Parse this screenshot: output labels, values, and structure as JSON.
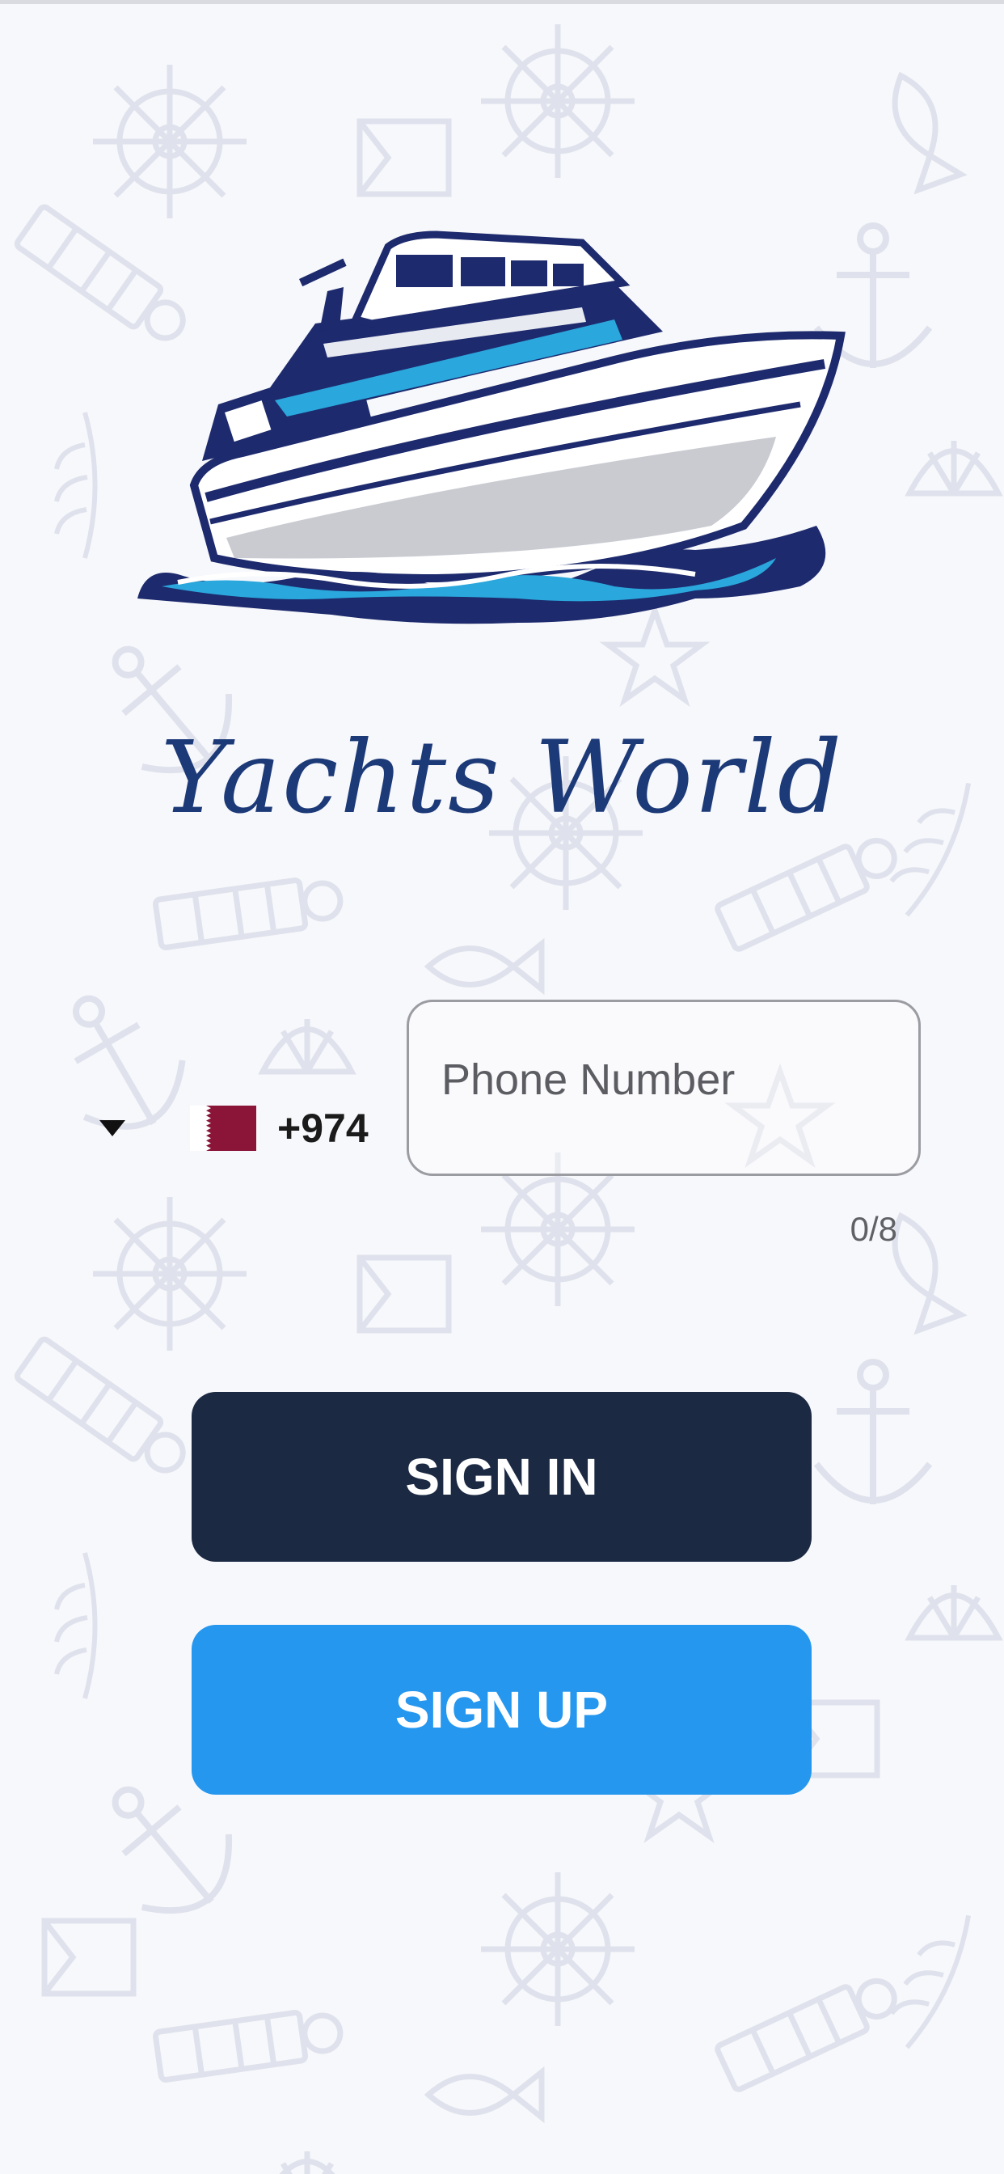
{
  "app": {
    "brand_name": "Yachts World"
  },
  "phone": {
    "country_flag": "qatar-flag",
    "dial_code": "+974",
    "placeholder": "Phone Number",
    "value": "",
    "counter": "0/8"
  },
  "actions": {
    "sign_in_label": "SIGN IN",
    "sign_up_label": "SIGN UP"
  },
  "colors": {
    "background": "#f7f8fb",
    "brand_navy": "#1d3a78",
    "sign_in_bg": "#1b2943",
    "sign_up_bg": "#2597ef",
    "flag_maroon": "#8a1538"
  },
  "background_pattern_icons": [
    "ship-wheel-icon",
    "anchor-icon",
    "lighthouse-icon",
    "fish-icon",
    "shell-icon",
    "starfish-icon",
    "sailboat-icon",
    "leaf-icon"
  ]
}
